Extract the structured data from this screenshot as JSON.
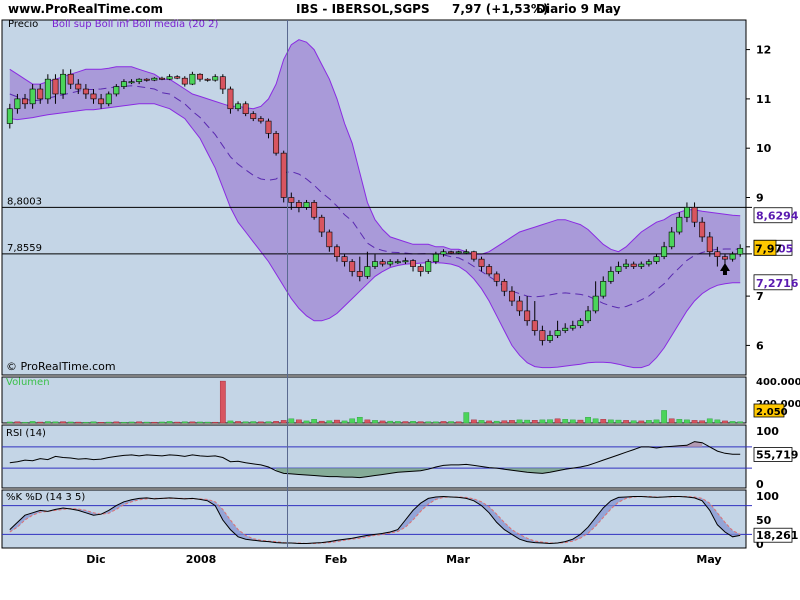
{
  "header": {
    "site": "www.ProRealTime.com",
    "title": "IBS - IBERSOL,SGPS",
    "quote": "7,97 (+1,53%)",
    "period": "Diario  9 May"
  },
  "watermark": "© ProRealTime.com",
  "colors": {
    "background": "#ffffff",
    "panel": "#c4d5e6",
    "band_fill": "#a99ad9",
    "band_line": "#8a2be2",
    "up_candle": "#4bd45a",
    "down_candle": "#d85560",
    "rsi_fill": "#7aa58a",
    "stoch_k": "#000000",
    "stoch_d": "#e07070",
    "blue_line": "#3030c0"
  },
  "chart_data": [
    {
      "type": "candlestick",
      "panel": "price",
      "title": "Precio",
      "legend": "Boll sup Boll inf Boll media (20 2)",
      "ylim": [
        5.4,
        12.6
      ],
      "yticks": [
        "6",
        "7",
        "8",
        "9",
        "10",
        "11",
        "12"
      ],
      "x_labels": [
        "Dic",
        "2008",
        "Feb",
        "Mar",
        "Abr",
        "May"
      ],
      "reference_lines": [
        {
          "value": 8.8003,
          "label": "8,8003"
        },
        {
          "value": 7.8559,
          "label": "7,8559"
        }
      ],
      "bollinger": {
        "upper_label": "8,6294",
        "lower_label": "7,2716",
        "middle_label": "05",
        "upper": [
          11.6,
          11.5,
          11.4,
          11.3,
          11.3,
          11.35,
          11.4,
          11.45,
          11.5,
          11.55,
          11.6,
          11.6,
          11.6,
          11.62,
          11.65,
          11.65,
          11.65,
          11.6,
          11.55,
          11.5,
          11.4,
          11.4,
          11.3,
          11.2,
          11.1,
          11.05,
          11.0,
          10.95,
          10.9,
          10.85,
          10.85,
          10.82,
          10.8,
          10.85,
          11.0,
          11.3,
          11.8,
          12.1,
          12.2,
          12.15,
          12.0,
          11.7,
          11.4,
          11.0,
          10.5,
          10.1,
          9.5,
          8.9,
          8.55,
          8.35,
          8.2,
          8.15,
          8.1,
          8.05,
          8.05,
          8.05,
          8.0,
          8.0,
          7.95,
          7.95,
          7.9,
          7.85,
          7.85,
          7.9,
          8.0,
          8.1,
          8.2,
          8.3,
          8.35,
          8.4,
          8.45,
          8.5,
          8.55,
          8.55,
          8.5,
          8.45,
          8.35,
          8.2,
          8.05,
          7.95,
          7.9,
          8.0,
          8.15,
          8.3,
          8.4,
          8.5,
          8.55,
          8.65,
          8.7,
          8.75,
          8.75,
          8.72,
          8.7,
          8.68,
          8.66,
          8.64,
          8.63
        ],
        "lower": [
          10.6,
          10.58,
          10.6,
          10.62,
          10.65,
          10.68,
          10.7,
          10.72,
          10.74,
          10.76,
          10.78,
          10.78,
          10.8,
          10.82,
          10.84,
          10.86,
          10.88,
          10.9,
          10.9,
          10.9,
          10.85,
          10.8,
          10.7,
          10.6,
          10.4,
          10.2,
          9.9,
          9.6,
          9.2,
          8.8,
          8.5,
          8.3,
          8.1,
          7.9,
          7.7,
          7.45,
          7.2,
          6.95,
          6.75,
          6.6,
          6.5,
          6.5,
          6.55,
          6.65,
          6.8,
          6.95,
          7.1,
          7.25,
          7.4,
          7.5,
          7.58,
          7.62,
          7.65,
          7.66,
          7.67,
          7.68,
          7.68,
          7.67,
          7.65,
          7.6,
          7.5,
          7.35,
          7.15,
          6.9,
          6.6,
          6.3,
          6.0,
          5.8,
          5.65,
          5.57,
          5.55,
          5.55,
          5.56,
          5.58,
          5.6,
          5.62,
          5.65,
          5.66,
          5.66,
          5.65,
          5.62,
          5.58,
          5.55,
          5.55,
          5.6,
          5.75,
          5.95,
          6.2,
          6.45,
          6.7,
          6.9,
          7.05,
          7.15,
          7.22,
          7.25,
          7.27,
          7.27
        ]
      },
      "candles": [
        [
          10.5,
          10.8,
          10.4,
          10.9
        ],
        [
          10.8,
          11.0,
          10.7,
          11.1
        ],
        [
          11.0,
          10.9,
          10.8,
          11.1
        ],
        [
          10.9,
          11.2,
          10.8,
          11.3
        ],
        [
          11.2,
          11.0,
          10.9,
          11.3
        ],
        [
          11.0,
          11.4,
          10.9,
          11.5
        ],
        [
          11.4,
          11.1,
          10.9,
          11.5
        ],
        [
          11.1,
          11.5,
          11.0,
          11.6
        ],
        [
          11.5,
          11.3,
          11.2,
          11.6
        ],
        [
          11.3,
          11.2,
          11.1,
          11.4
        ],
        [
          11.2,
          11.1,
          11.0,
          11.3
        ],
        [
          11.1,
          11.0,
          10.9,
          11.2
        ],
        [
          11.0,
          10.9,
          10.8,
          11.1
        ],
        [
          10.9,
          11.1,
          10.85,
          11.15
        ],
        [
          11.1,
          11.25,
          11.05,
          11.3
        ],
        [
          11.25,
          11.35,
          11.2,
          11.4
        ],
        [
          11.35,
          11.35,
          11.3,
          11.4
        ],
        [
          11.35,
          11.4,
          11.3,
          11.42
        ],
        [
          11.4,
          11.38,
          11.35,
          11.42
        ],
        [
          11.38,
          11.42,
          11.36,
          11.44
        ],
        [
          11.42,
          11.4,
          11.38,
          11.45
        ],
        [
          11.4,
          11.45,
          11.38,
          11.5
        ],
        [
          11.45,
          11.42,
          11.4,
          11.48
        ],
        [
          11.42,
          11.3,
          11.25,
          11.46
        ],
        [
          11.3,
          11.5,
          11.28,
          11.55
        ],
        [
          11.5,
          11.4,
          11.35,
          11.52
        ],
        [
          11.4,
          11.38,
          11.35,
          11.42
        ],
        [
          11.38,
          11.45,
          11.35,
          11.5
        ],
        [
          11.45,
          11.2,
          11.1,
          11.5
        ],
        [
          11.2,
          10.8,
          10.7,
          11.25
        ],
        [
          10.8,
          10.9,
          10.75,
          10.95
        ],
        [
          10.9,
          10.7,
          10.65,
          10.95
        ],
        [
          10.7,
          10.6,
          10.55,
          10.75
        ],
        [
          10.6,
          10.55,
          10.5,
          10.65
        ],
        [
          10.55,
          10.3,
          10.2,
          10.6
        ],
        [
          10.3,
          9.9,
          9.85,
          10.35
        ],
        [
          9.9,
          9.0,
          8.9,
          9.95
        ],
        [
          9.0,
          8.9,
          8.75,
          9.1
        ],
        [
          8.9,
          8.8,
          8.7,
          8.95
        ],
        [
          8.8,
          8.9,
          8.75,
          8.95
        ],
        [
          8.9,
          8.6,
          8.55,
          8.95
        ],
        [
          8.6,
          8.3,
          8.2,
          8.65
        ],
        [
          8.3,
          8.0,
          7.9,
          8.35
        ],
        [
          8.0,
          7.8,
          7.7,
          8.05
        ],
        [
          7.8,
          7.7,
          7.6,
          7.85
        ],
        [
          7.7,
          7.5,
          7.4,
          7.75
        ],
        [
          7.5,
          7.4,
          7.3,
          7.8
        ],
        [
          7.4,
          7.6,
          7.35,
          7.9
        ],
        [
          7.6,
          7.7,
          7.55,
          7.85
        ],
        [
          7.7,
          7.65,
          7.6,
          7.75
        ],
        [
          7.65,
          7.7,
          7.6,
          7.75
        ],
        [
          7.7,
          7.7,
          7.65,
          7.75
        ],
        [
          7.7,
          7.72,
          7.65,
          7.78
        ],
        [
          7.72,
          7.6,
          7.5,
          7.75
        ],
        [
          7.6,
          7.5,
          7.4,
          7.65
        ],
        [
          7.5,
          7.7,
          7.45,
          7.75
        ],
        [
          7.7,
          7.85,
          7.65,
          7.9
        ],
        [
          7.85,
          7.9,
          7.8,
          7.95
        ],
        [
          7.9,
          7.88,
          7.85,
          7.92
        ],
        [
          7.88,
          7.9,
          7.85,
          7.92
        ],
        [
          7.9,
          7.9,
          7.85,
          7.95
        ],
        [
          7.9,
          7.75,
          7.7,
          7.92
        ],
        [
          7.75,
          7.6,
          7.5,
          7.8
        ],
        [
          7.6,
          7.45,
          7.4,
          7.65
        ],
        [
          7.45,
          7.3,
          7.2,
          7.5
        ],
        [
          7.3,
          7.1,
          7.0,
          7.35
        ],
        [
          7.1,
          6.9,
          6.8,
          7.2
        ],
        [
          6.9,
          6.7,
          6.6,
          7.0
        ],
        [
          6.7,
          6.5,
          6.4,
          7.0
        ],
        [
          6.5,
          6.3,
          6.2,
          6.9
        ],
        [
          6.3,
          6.1,
          6.0,
          6.4
        ],
        [
          6.1,
          6.2,
          6.05,
          6.3
        ],
        [
          6.2,
          6.3,
          6.15,
          6.5
        ],
        [
          6.3,
          6.35,
          6.25,
          6.45
        ],
        [
          6.35,
          6.4,
          6.3,
          6.5
        ],
        [
          6.4,
          6.5,
          6.35,
          6.55
        ],
        [
          6.5,
          6.7,
          6.45,
          6.8
        ],
        [
          6.7,
          7.0,
          6.65,
          7.3
        ],
        [
          7.0,
          7.3,
          6.95,
          7.4
        ],
        [
          7.3,
          7.5,
          7.25,
          7.6
        ],
        [
          7.5,
          7.6,
          7.45,
          7.7
        ],
        [
          7.6,
          7.65,
          7.55,
          7.75
        ],
        [
          7.65,
          7.6,
          7.55,
          7.7
        ],
        [
          7.6,
          7.65,
          7.55,
          7.7
        ],
        [
          7.65,
          7.7,
          7.6,
          7.75
        ],
        [
          7.7,
          7.8,
          7.65,
          7.85
        ],
        [
          7.8,
          8.0,
          7.75,
          8.1
        ],
        [
          8.0,
          8.3,
          7.95,
          8.4
        ],
        [
          8.3,
          8.6,
          8.25,
          8.7
        ],
        [
          8.6,
          8.8,
          8.5,
          8.9
        ],
        [
          8.8,
          8.5,
          8.4,
          8.9
        ],
        [
          8.5,
          8.2,
          8.1,
          8.6
        ],
        [
          8.2,
          7.9,
          7.8,
          8.3
        ],
        [
          7.9,
          7.8,
          7.6,
          8.0
        ],
        [
          7.8,
          7.75,
          7.6,
          7.85
        ],
        [
          7.75,
          7.85,
          7.7,
          7.9
        ],
        [
          7.85,
          7.97,
          7.8,
          8.05
        ]
      ]
    },
    {
      "type": "bar",
      "panel": "volume",
      "title": "Volumen",
      "ylim": [
        0,
        420000
      ],
      "yticks": [
        "400.000",
        "200.000"
      ],
      "last_value": "2.050",
      "values": [
        10000,
        12000,
        8000,
        15000,
        9000,
        14000,
        11000,
        13000,
        10000,
        9000,
        8000,
        12000,
        7000,
        9000,
        11000,
        8000,
        10000,
        12000,
        9000,
        8000,
        10000,
        15000,
        9000,
        12000,
        11000,
        10000,
        9000,
        8000,
        400000,
        20000,
        15000,
        12000,
        14000,
        11000,
        13000,
        16000,
        25000,
        40000,
        30000,
        20000,
        35000,
        18000,
        22000,
        28000,
        20000,
        40000,
        55000,
        30000,
        25000,
        20000,
        18000,
        15000,
        14000,
        16000,
        13000,
        12000,
        11000,
        15000,
        14000,
        12000,
        100000,
        30000,
        25000,
        20000,
        18000,
        22000,
        25000,
        30000,
        28000,
        26000,
        30000,
        32000,
        40000,
        35000,
        30000,
        28000,
        55000,
        40000,
        35000,
        30000,
        28000,
        25000,
        22000,
        20000,
        25000,
        30000,
        120000,
        40000,
        35000,
        30000,
        25000,
        22000,
        40000,
        30000,
        20000,
        15000,
        12000
      ],
      "up": [
        1,
        0,
        1,
        1,
        0,
        1,
        1,
        0,
        1,
        0,
        1,
        1,
        0,
        1,
        0,
        1,
        1,
        0,
        1,
        0,
        1,
        1,
        0,
        1,
        0,
        1,
        1,
        0,
        0,
        1,
        0,
        1,
        1,
        0,
        1,
        0,
        0,
        1,
        0,
        1,
        1,
        0,
        1,
        0,
        1,
        1,
        1,
        0,
        1,
        0,
        1,
        1,
        0,
        1,
        0,
        1,
        1,
        0,
        1,
        0,
        1,
        0,
        1,
        0,
        1,
        0,
        0,
        1,
        1,
        0,
        1,
        1,
        0,
        1,
        1,
        0,
        1,
        1,
        0,
        1,
        1,
        0,
        1,
        0,
        1,
        1,
        1,
        0,
        1,
        1,
        0,
        0,
        1,
        1,
        0,
        1,
        1
      ]
    },
    {
      "type": "line",
      "panel": "rsi",
      "title": "RSI (14)",
      "ylim": [
        0,
        100
      ],
      "yticks": [
        "100",
        "50",
        "0"
      ],
      "levels": [
        70,
        30
      ],
      "last_value": "55,719",
      "values": [
        40,
        42,
        45,
        44,
        48,
        46,
        52,
        50,
        49,
        47,
        48,
        46,
        47,
        50,
        52,
        54,
        55,
        53,
        55,
        54,
        53,
        55,
        54,
        52,
        55,
        53,
        52,
        53,
        50,
        42,
        43,
        40,
        38,
        36,
        32,
        25,
        20,
        19,
        18,
        17,
        16,
        15,
        14,
        14,
        13,
        13,
        12,
        14,
        16,
        18,
        20,
        22,
        23,
        24,
        25,
        28,
        32,
        35,
        36,
        36,
        37,
        35,
        33,
        31,
        30,
        28,
        26,
        24,
        22,
        21,
        20,
        22,
        25,
        28,
        30,
        32,
        35,
        40,
        45,
        50,
        55,
        60,
        65,
        70,
        70,
        68,
        70,
        71,
        72,
        73,
        80,
        78,
        70,
        62,
        58,
        56,
        56
      ]
    },
    {
      "type": "line",
      "panel": "stochastic",
      "title": "%K %D (14 3 5)",
      "ylim": [
        0,
        100
      ],
      "yticks": [
        "100",
        "50",
        "0"
      ],
      "levels": [
        80,
        20
      ],
      "last_value": "18,261",
      "k": [
        30,
        45,
        60,
        65,
        70,
        68,
        72,
        75,
        73,
        70,
        65,
        60,
        62,
        70,
        80,
        88,
        92,
        95,
        96,
        94,
        95,
        96,
        95,
        94,
        95,
        93,
        90,
        80,
        50,
        30,
        15,
        10,
        8,
        6,
        5,
        3,
        2,
        2,
        1,
        1,
        2,
        3,
        5,
        8,
        10,
        12,
        15,
        18,
        20,
        22,
        25,
        30,
        50,
        70,
        85,
        95,
        98,
        99,
        98,
        97,
        95,
        90,
        80,
        65,
        45,
        30,
        20,
        10,
        5,
        3,
        2,
        1,
        2,
        5,
        10,
        20,
        35,
        55,
        75,
        90,
        97,
        98,
        99,
        99,
        98,
        97,
        98,
        99,
        99,
        98,
        96,
        90,
        70,
        40,
        25,
        15,
        18
      ],
      "d": [
        25,
        35,
        50,
        60,
        66,
        68,
        70,
        72,
        74,
        73,
        70,
        65,
        62,
        64,
        72,
        82,
        88,
        92,
        94,
        95,
        95,
        95,
        95,
        95,
        94,
        94,
        93,
        88,
        72,
        50,
        30,
        18,
        11,
        8,
        6,
        5,
        3,
        2,
        2,
        1,
        1,
        2,
        3,
        5,
        8,
        10,
        12,
        15,
        18,
        20,
        23,
        26,
        35,
        50,
        68,
        83,
        93,
        97,
        98,
        98,
        97,
        94,
        88,
        78,
        62,
        45,
        30,
        20,
        12,
        6,
        4,
        2,
        2,
        3,
        6,
        12,
        22,
        37,
        55,
        73,
        87,
        95,
        98,
        99,
        99,
        98,
        98,
        98,
        99,
        99,
        98,
        95,
        85,
        65,
        45,
        28,
        20
      ]
    }
  ]
}
